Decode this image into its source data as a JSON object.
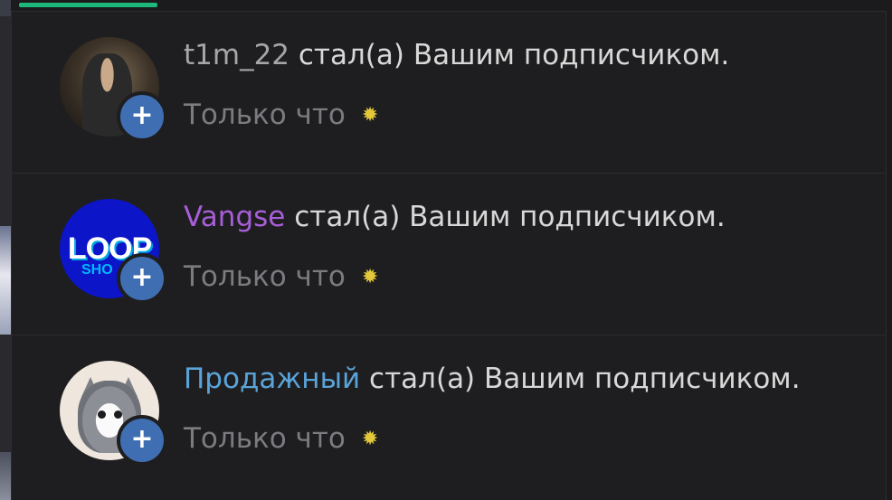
{
  "notifications": [
    {
      "username": "t1m_22",
      "username_color": "#a6a6a6",
      "message": " стал(а) Вашим подписчиком.",
      "time": "Только что",
      "new_indicator": "✹",
      "avatar_icon": "user-photo",
      "follow_label": "+"
    },
    {
      "username": "Vangse",
      "username_color": "#a85ed9",
      "message": " стал(а) Вашим подписчиком.",
      "time": "Только что",
      "new_indicator": "✹",
      "avatar_icon": "loop-logo",
      "avatar_text": "LOOP",
      "avatar_subtext": "SHO",
      "follow_label": "+"
    },
    {
      "username": "Продажный",
      "username_color": "#5aa3d8",
      "message": " стал(а) Вашим подписчиком.",
      "time": "Только что",
      "new_indicator": "✹",
      "avatar_icon": "kitten-photo",
      "follow_label": "+"
    }
  ],
  "colors": {
    "accent": "#1db97a",
    "follow_button": "#3f6fb2",
    "background": "#1e1e20"
  }
}
